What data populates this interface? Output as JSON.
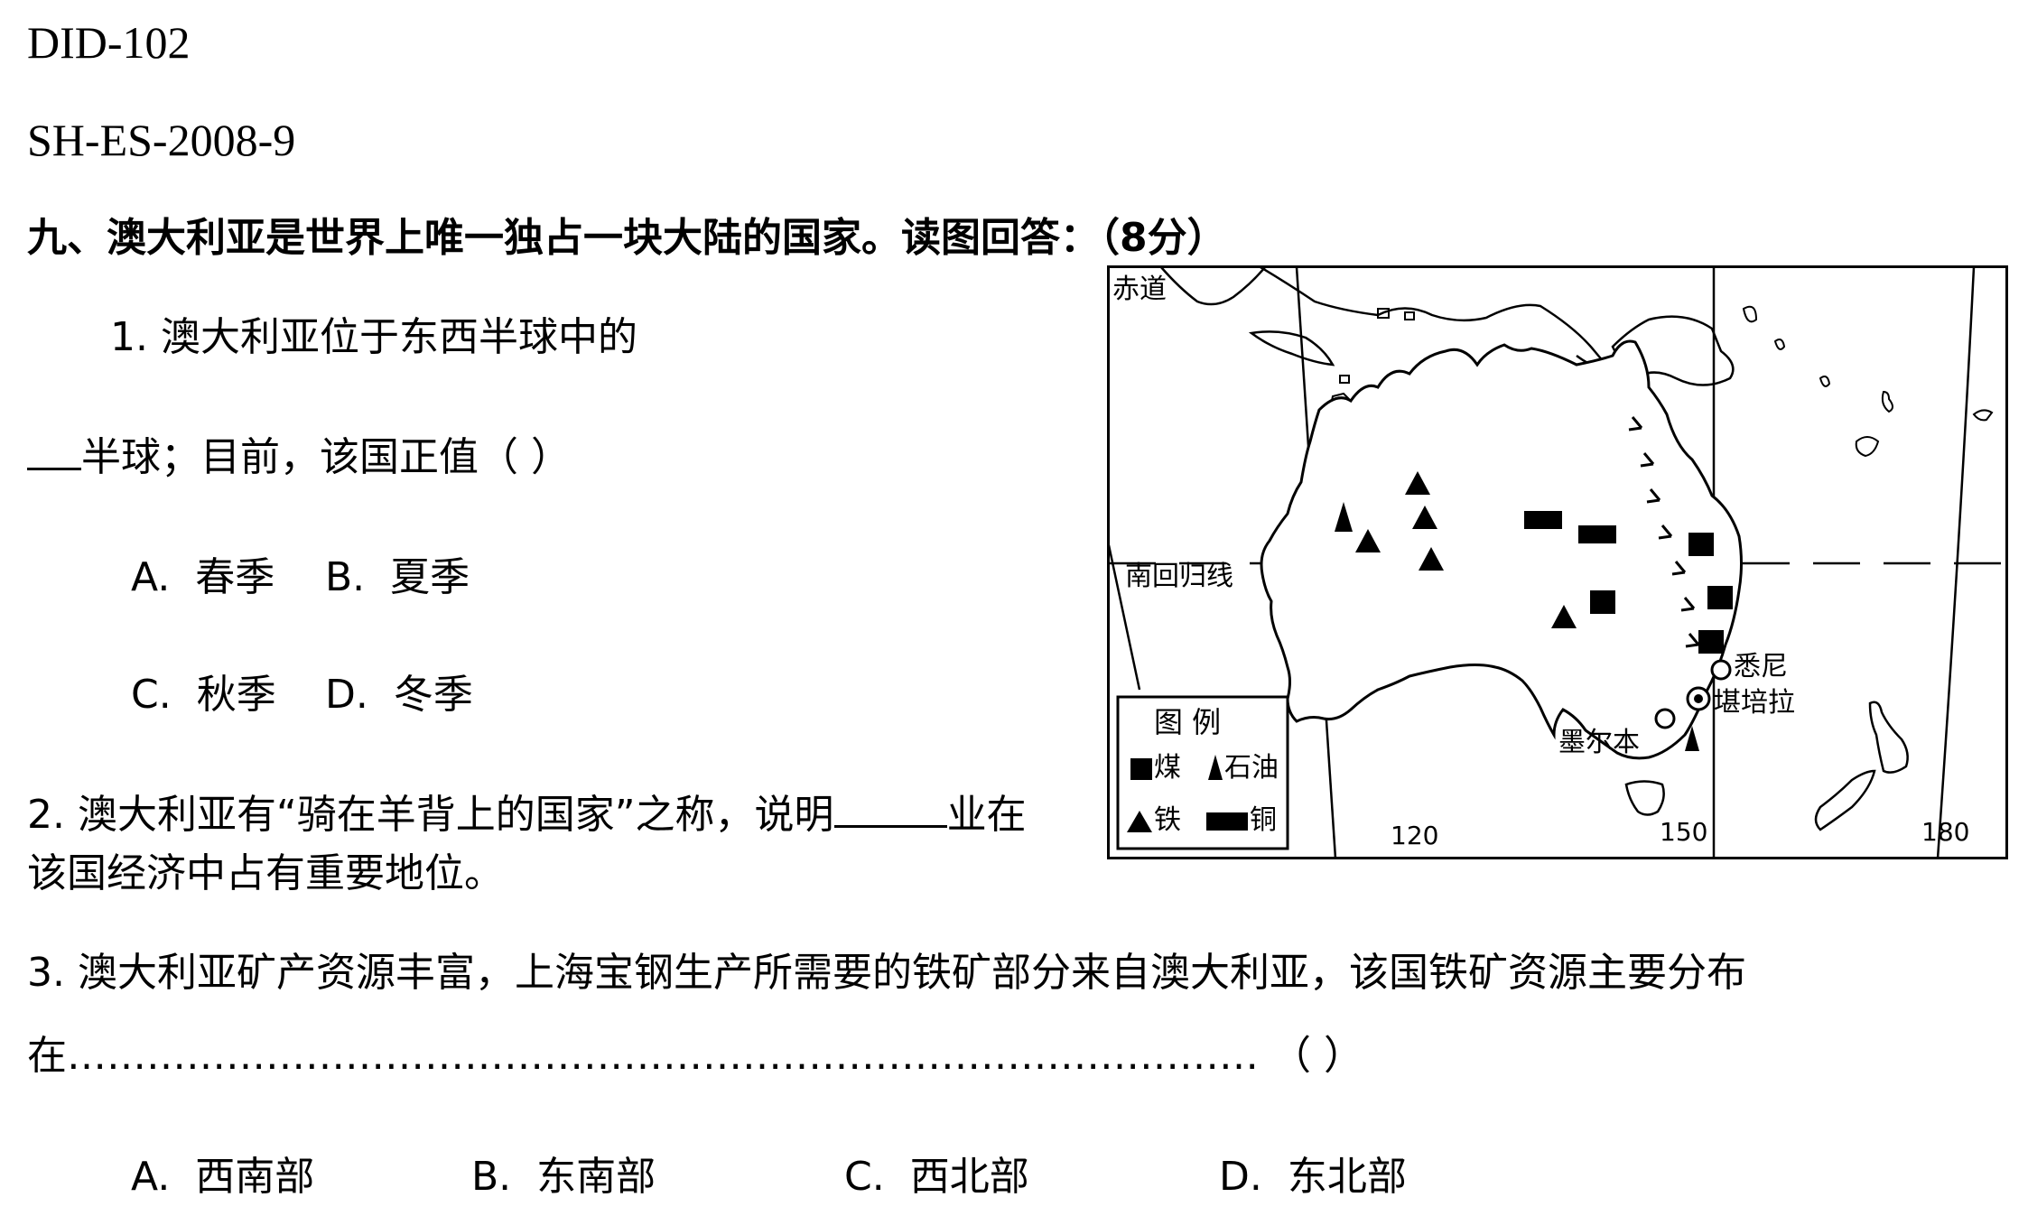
{
  "header": {
    "doc_id": "DID-102",
    "source_code": "SH-ES-2008-9"
  },
  "question": {
    "title": "九、澳大利亚是世界上唯一独占一块大陆的国家。读图回答：（8分）",
    "q1": {
      "line1": "1.  澳大利亚位于东西半球中的",
      "line2_after_blank": "半球；目前，该国正值（    ）",
      "options": [
        {
          "letter": "A.",
          "text": "春季"
        },
        {
          "letter": "B.",
          "text": "夏季"
        },
        {
          "letter": "C.",
          "text": "秋季"
        },
        {
          "letter": "D.",
          "text": "冬季"
        }
      ]
    },
    "q2": {
      "line1_before_blank": "2.  澳大利亚有“骑在羊背上的国家”之称，说明",
      "line1_after_blank": "业在",
      "line2": "该国经济中占有重要地位。"
    },
    "q3": {
      "line1": "3.  澳大利亚矿产资源丰富，上海宝钢生产所需要的铁矿部分来自澳大利亚，该国铁矿资源主要分布",
      "line2": "在……………………………………………………………………………… （    ）",
      "options": [
        {
          "letter": "A.",
          "text": "西南部"
        },
        {
          "letter": "B.",
          "text": "东南部"
        },
        {
          "letter": "C.",
          "text": "西北部"
        },
        {
          "letter": "D.",
          "text": "东北部"
        }
      ]
    }
  },
  "map": {
    "equator_label": "赤道",
    "tropic_label": "南回归线",
    "longitude_ticks": [
      "120",
      "150",
      "180"
    ],
    "cities": {
      "sydney": "悉尼",
      "canberra": "堪培拉",
      "melbourne": "墨尔本"
    },
    "legend": {
      "title": "图    例",
      "coal": "煤",
      "oil": "石油",
      "iron": "铁",
      "copper": "铜"
    }
  }
}
